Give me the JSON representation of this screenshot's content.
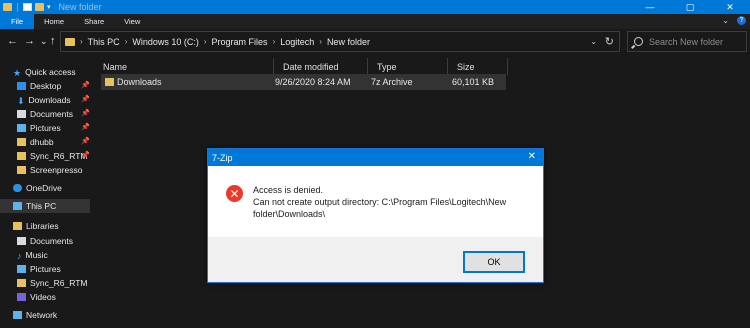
{
  "window": {
    "title": "New folder",
    "controls": {
      "minimize": "—",
      "maximize": "▢",
      "close": "✕"
    }
  },
  "ribbon": {
    "tabs": [
      "File",
      "Home",
      "Share",
      "View"
    ]
  },
  "navigation": {
    "back": "←",
    "forward": "→",
    "dropdown": "⌄",
    "up": "↑",
    "breadcrumbs": [
      "This PC",
      "Windows 10 (C:)",
      "Program Files",
      "Logitech",
      "New folder"
    ],
    "search_placeholder": "Search New folder"
  },
  "sidebar": {
    "items": [
      {
        "label": "Quick access",
        "icon": "star-icon",
        "pinned": false
      },
      {
        "label": "Desktop",
        "icon": "desktop-icon",
        "pinned": true
      },
      {
        "label": "Downloads",
        "icon": "downloads-icon",
        "pinned": true
      },
      {
        "label": "Documents",
        "icon": "documents-icon",
        "pinned": true
      },
      {
        "label": "Pictures",
        "icon": "pictures-icon",
        "pinned": true
      },
      {
        "label": "dhubb",
        "icon": "folder-icon",
        "pinned": true
      },
      {
        "label": "Sync_R6_RTM",
        "icon": "folder-icon",
        "pinned": true
      },
      {
        "label": "Screenpresso",
        "icon": "folder-icon",
        "pinned": false
      },
      {
        "label": "OneDrive",
        "icon": "cloud-icon",
        "pinned": false
      },
      {
        "label": "This PC",
        "icon": "computer-icon",
        "pinned": false
      },
      {
        "label": "Libraries",
        "icon": "libraries-icon",
        "pinned": false
      },
      {
        "label": "Documents",
        "icon": "documents-icon",
        "pinned": false
      },
      {
        "label": "Music",
        "icon": "music-icon",
        "pinned": false
      },
      {
        "label": "Pictures",
        "icon": "pictures-icon",
        "pinned": false
      },
      {
        "label": "Sync_R6_RTM",
        "icon": "folder-icon",
        "pinned": false
      },
      {
        "label": "Videos",
        "icon": "videos-icon",
        "pinned": false
      },
      {
        "label": "Network",
        "icon": "network-icon",
        "pinned": false
      }
    ]
  },
  "filelist": {
    "columns": [
      "Name",
      "Date modified",
      "Type",
      "Size"
    ],
    "rows": [
      {
        "name": "Downloads",
        "date": "9/26/2020 8:24 AM",
        "type": "7z Archive",
        "size": "60,101 KB"
      }
    ]
  },
  "dialog": {
    "title": "7-Zip",
    "close": "✕",
    "line1": "Access is denied.",
    "line2": "Can not create output directory: C:\\Program Files\\Logitech\\New",
    "line3": "folder\\Downloads\\",
    "ok": "OK"
  },
  "colors": {
    "accent": "#0078d7",
    "error": "#e8392b",
    "folder": "#e8c15e",
    "background": "#191919"
  }
}
